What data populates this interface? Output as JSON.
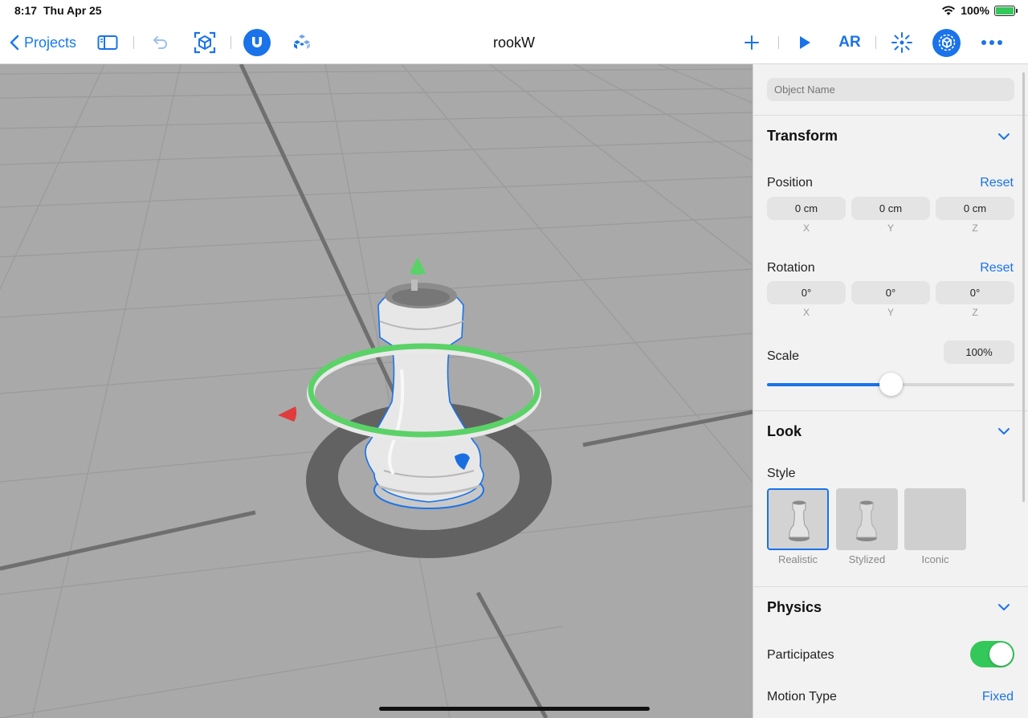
{
  "status": {
    "time": "8:17",
    "date": "Thu Apr 25",
    "battery": "100%"
  },
  "toolbar": {
    "back_label": "Projects",
    "title": "rookW",
    "ar_label": "AR",
    "icons": [
      "sidebar-icon",
      "undo-icon",
      "ar-scan-icon",
      "magnet-icon",
      "scene-hierarchy-icon",
      "plus-icon",
      "play-icon",
      "ar-button",
      "focus-icon",
      "properties-icon",
      "more-icon"
    ]
  },
  "viewport": {
    "object": "rook chess piece",
    "gizmo_colors": {
      "y_axis": "#4cd964",
      "x_axis": "#e53935",
      "z_axis": "#1a73e8",
      "rotation_ring": "#4cd964",
      "outline": "#1a73e8"
    }
  },
  "inspector": {
    "object_name_placeholder": "Object Name",
    "transform": {
      "title": "Transform",
      "position": {
        "label": "Position",
        "reset": "Reset",
        "x": "0 cm",
        "y": "0 cm",
        "z": "0 cm"
      },
      "rotation": {
        "label": "Rotation",
        "reset": "Reset",
        "x": "0°",
        "y": "0°",
        "z": "0°"
      },
      "axes": {
        "x": "X",
        "y": "Y",
        "z": "Z"
      },
      "scale": {
        "label": "Scale",
        "value": "100%",
        "slider_fraction": 0.5
      }
    },
    "look": {
      "title": "Look",
      "style_label": "Style",
      "styles": [
        {
          "label": "Realistic",
          "selected": true
        },
        {
          "label": "Stylized",
          "selected": false
        },
        {
          "label": "Iconic",
          "selected": false
        }
      ]
    },
    "physics": {
      "title": "Physics",
      "participates_label": "Participates",
      "participates": true,
      "motion_type_label": "Motion Type",
      "motion_type_value": "Fixed"
    }
  },
  "colors": {
    "accent": "#1a73e8",
    "toggle_on": "#34c759",
    "panel_bg": "#f2f2f2",
    "viewport_bg": "#a9a9a9"
  }
}
